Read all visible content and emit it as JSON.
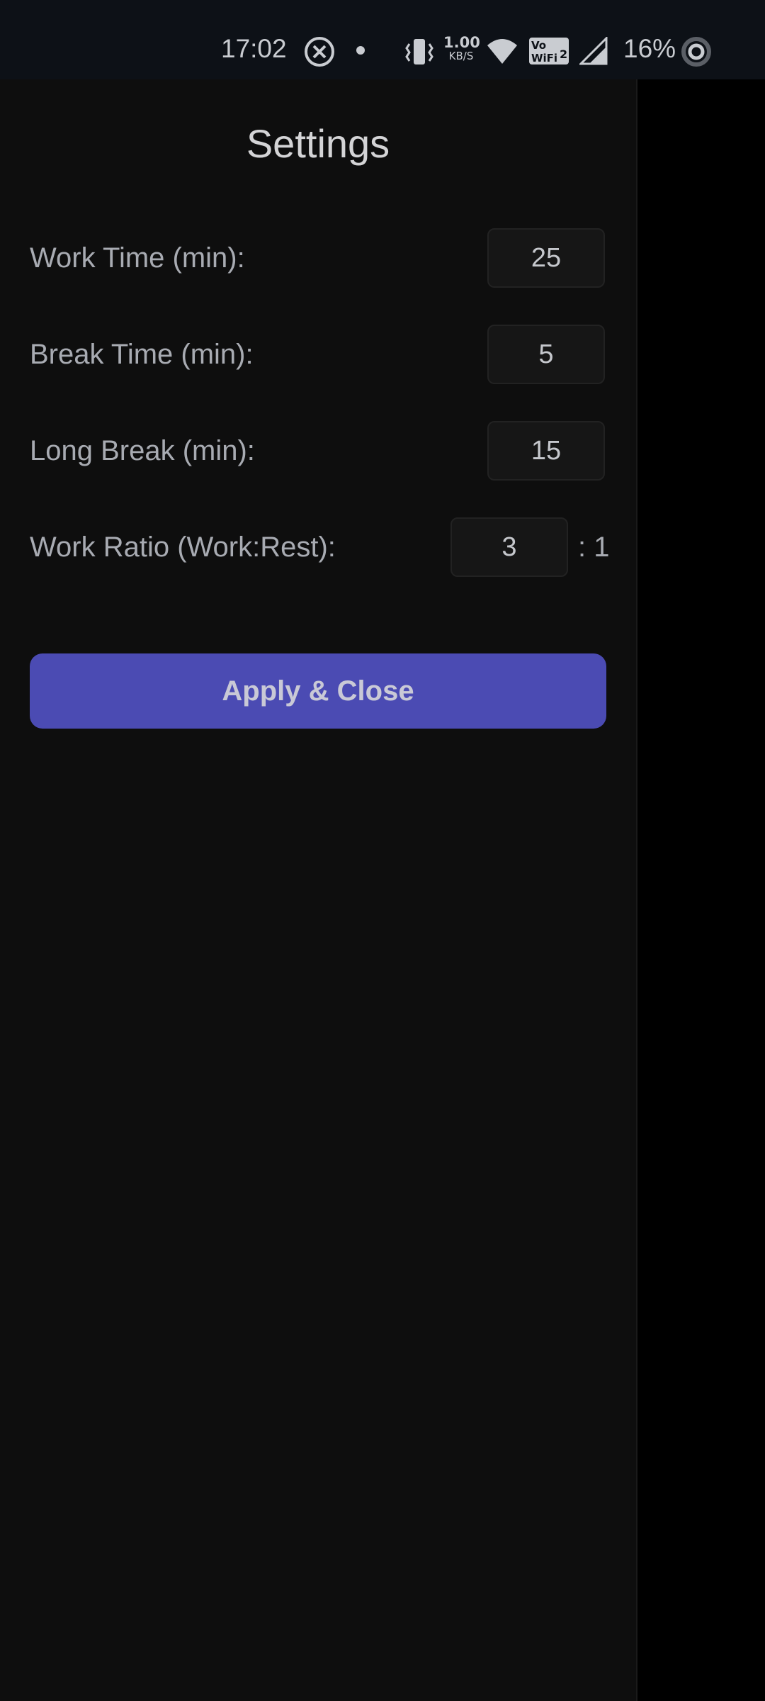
{
  "status_bar": {
    "time": "17:02",
    "speed_value": "1.00",
    "speed_unit": "KB/S",
    "battery_percent": "16%",
    "icons": [
      "no-sim-icon",
      "dot-icon",
      "vibrate-icon",
      "network-speed",
      "wifi-icon",
      "vowifi-icon",
      "signal-icon",
      "battery-ring-icon"
    ]
  },
  "settings": {
    "title": "Settings",
    "work_time": {
      "label": "Work Time (min):",
      "value": "25"
    },
    "break_time": {
      "label": "Break Time (min):",
      "value": "5"
    },
    "long_break": {
      "label": "Long Break (min):",
      "value": "15"
    },
    "work_ratio": {
      "label": "Work Ratio (Work:Rest):",
      "value": "3",
      "suffix": ": 1"
    },
    "apply_label": "Apply & Close"
  },
  "colors": {
    "status_bar_bg": "#0d1117",
    "drawer_bg": "#0e0e0e",
    "accent": "#4b4bb3",
    "label_text": "#a8abb2"
  }
}
